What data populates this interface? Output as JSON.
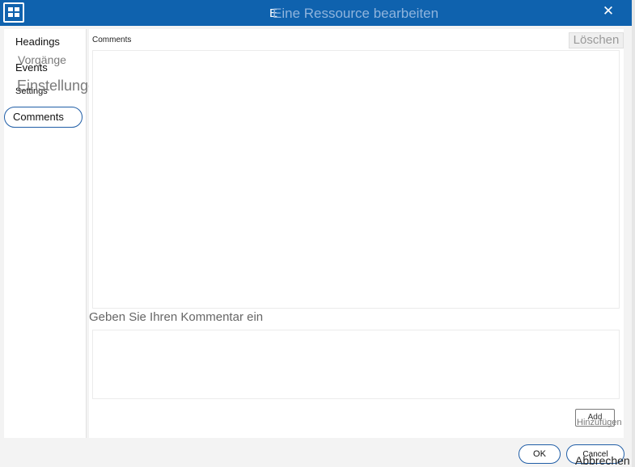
{
  "window": {
    "title_original": "E",
    "title_translated": "Eine Ressource bearbeiten",
    "close_glyph": "✕",
    "accent_color": "#0f62ae"
  },
  "sidebar": {
    "items": [
      {
        "label": "Headings"
      },
      {
        "label": "Events",
        "overlay": "Vorgänge"
      },
      {
        "label": "Settings",
        "overlay": "Einstellungen"
      },
      {
        "label": "Comments",
        "selected": true
      }
    ]
  },
  "main": {
    "section_label": "Comments",
    "delete_button": "Löschen",
    "input_label": "Geben Sie Ihren Kommentar ein",
    "input_value": "",
    "add_button": "Add",
    "add_button_overlay": "Hinzufügen"
  },
  "footer": {
    "ok_button": "OK",
    "cancel_button": "Cancel",
    "cancel_button_overlay": "Abbrechen"
  }
}
